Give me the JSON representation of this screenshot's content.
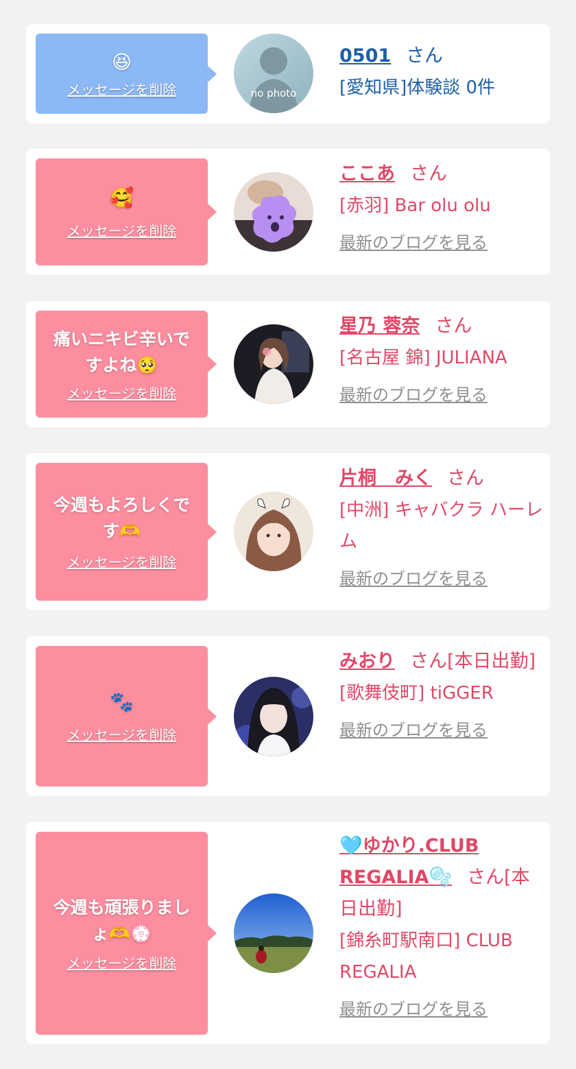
{
  "entries": [
    {
      "message": "😆",
      "delete_label": "メッセージを削除",
      "name": "0501",
      "suffix": "さん",
      "shop": "[愛知県]体験談 0件",
      "blog_label": "",
      "avatar_label": "no photo"
    },
    {
      "message": "🥰",
      "delete_label": "メッセージを削除",
      "name": "ここあ",
      "suffix": "さん",
      "shop": "[赤羽] Bar olu olu",
      "blog_label": "最新のブログを見る"
    },
    {
      "message": "痛いニキビ辛いですよね🥺",
      "delete_label": "メッセージを削除",
      "name": "星乃 蓉奈",
      "suffix": "さん",
      "shop": "[名古屋 錦] JULIANA",
      "blog_label": "最新のブログを見る"
    },
    {
      "message": "今週もよろしくです🫶",
      "delete_label": "メッセージを削除",
      "name": "片桐　みく",
      "suffix": "さん",
      "shop": "[中洲] キャバクラ ハーレム",
      "blog_label": "最新のブログを見る"
    },
    {
      "message": "🐾",
      "delete_label": "メッセージを削除",
      "name": "みおり",
      "suffix": "さん[本日出勤]",
      "shop": "[歌舞伎町] tiGGER",
      "blog_label": "最新のブログを見る"
    },
    {
      "message": "今週も頑張りましょ🫶💮",
      "delete_label": "メッセージを削除",
      "name": "🩵ゆかり.CLUB REGALIA🫧",
      "suffix": "さん[本日出勤]",
      "shop": "[錦糸町駅南口] CLUB REGALIA",
      "blog_label": "最新のブログを見る"
    }
  ]
}
